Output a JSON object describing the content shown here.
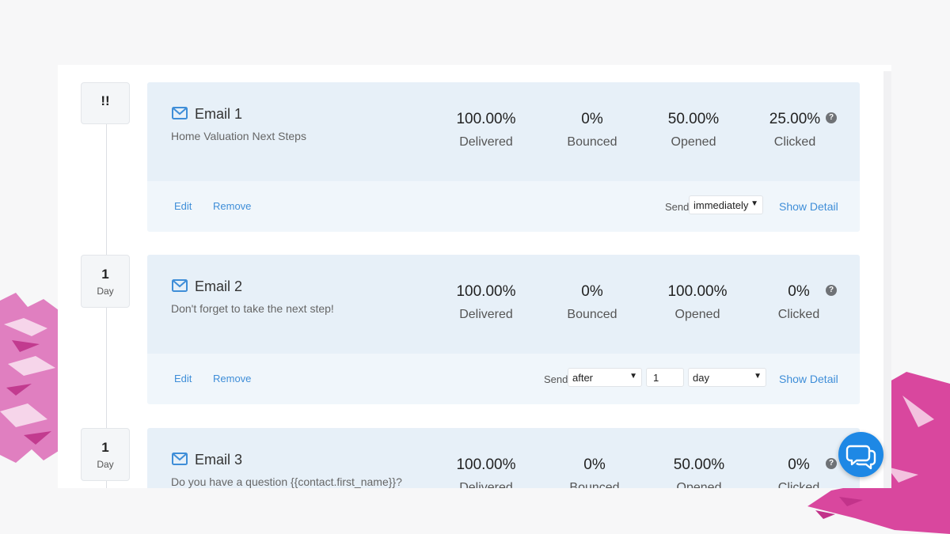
{
  "timeline": {
    "steps": [
      {
        "badge_main": "!!",
        "badge_unit": ""
      },
      {
        "badge_main": "1",
        "badge_unit": "Day"
      },
      {
        "badge_main": "1",
        "badge_unit": "Day"
      }
    ]
  },
  "emails": [
    {
      "title": "Email 1",
      "subject": "Home Valuation Next Steps",
      "stats": [
        {
          "value": "100.00%",
          "label": "Delivered"
        },
        {
          "value": "0%",
          "label": "Bounced"
        },
        {
          "value": "50.00%",
          "label": "Opened"
        },
        {
          "value": "25.00%",
          "label": "Clicked"
        }
      ],
      "edit_label": "Edit",
      "remove_label": "Remove",
      "send_label": "Send",
      "send_timing": "immediately",
      "show_detail_label": "Show Detail"
    },
    {
      "title": "Email 2",
      "subject": "Don't forget to take the next step!",
      "stats": [
        {
          "value": "100.00%",
          "label": "Delivered"
        },
        {
          "value": "0%",
          "label": "Bounced"
        },
        {
          "value": "100.00%",
          "label": "Opened"
        },
        {
          "value": "0%",
          "label": "Clicked"
        }
      ],
      "edit_label": "Edit",
      "remove_label": "Remove",
      "send_label": "Send",
      "send_timing": "after",
      "delay_amount": "1",
      "delay_unit": "day",
      "show_detail_label": "Show Detail"
    },
    {
      "title": "Email 3",
      "subject": "Do you have a question {{contact.first_name}}?",
      "stats": [
        {
          "value": "100.00%",
          "label": "Delivered"
        },
        {
          "value": "0%",
          "label": "Bounced"
        },
        {
          "value": "50.00%",
          "label": "Opened"
        },
        {
          "value": "0%",
          "label": "Clicked"
        }
      ]
    }
  ],
  "icons": {
    "email": "envelope-icon",
    "help": "question-circle-icon",
    "chat": "chat-bubbles-icon",
    "dropdown": "chevron-down-icon"
  },
  "colors": {
    "accent": "#3f8ed8",
    "card_top": "#e7f0f8",
    "card_bottom": "#f0f6fb",
    "chat_button": "#1e88e5",
    "splash": "#d9479e"
  }
}
